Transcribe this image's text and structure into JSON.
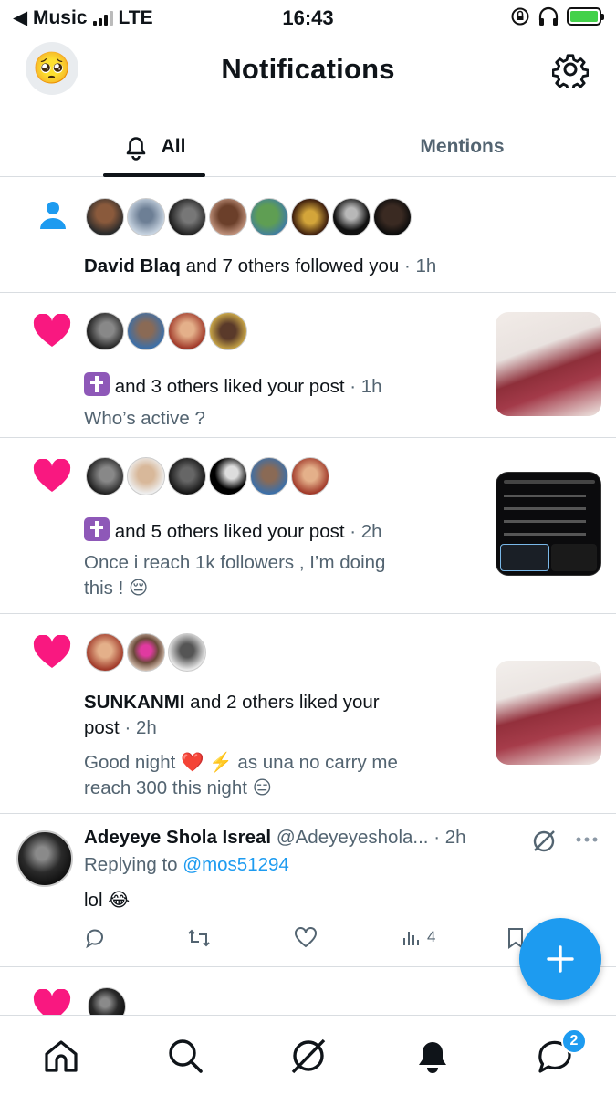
{
  "status_bar": {
    "back_app": "◀ Music",
    "network": "LTE",
    "time": "16:43"
  },
  "header": {
    "title": "Notifications",
    "avatar_emoji": "🥺"
  },
  "tabs": {
    "all": "All",
    "mentions": "Mentions"
  },
  "notifications": [
    {
      "type": "follow",
      "icon": "person-icon",
      "actor": "David Blaq",
      "text": " and 7 others followed you",
      "time": " · 1h",
      "avatar_count": 8
    },
    {
      "type": "like",
      "icon": "heart-icon",
      "actor_emoji": "✝️",
      "text": " and 3 others liked your post",
      "time": " · 1h",
      "snippet": "Who’s active ?",
      "avatar_count": 4
    },
    {
      "type": "like",
      "icon": "heart-icon",
      "actor_emoji": "✝️",
      "text": " and 5 others liked your post",
      "time": " · 2h",
      "snippet_line1": "Once i reach 1k followers , I’m doing",
      "snippet_line2": "this ! 😔",
      "avatar_count": 6
    },
    {
      "type": "like",
      "icon": "heart-icon",
      "actor": "SUNKANMI",
      "text_line1": " and 2 others liked your",
      "text_line2": "post",
      "time": " · 2h",
      "snippet_line1": "Good night ❤️ ⚡️ as una no carry me",
      "snippet_line2": "reach 300 this night 😑",
      "avatar_count": 3
    }
  ],
  "reply": {
    "name": "Adeyeye Shola Isreal",
    "handle": " @Adeyeyeshola...",
    "time": " · 2h",
    "replying_prefix": "Replying to ",
    "replying_to": "@mos51294",
    "body": "lol 😂",
    "views": "4"
  },
  "bottom_nav": {
    "messages_badge": "2"
  },
  "colors": {
    "accent": "#1d9bf0",
    "like": "#f91880",
    "muted": "#536471",
    "follow_icon": "#1d9bf0"
  }
}
